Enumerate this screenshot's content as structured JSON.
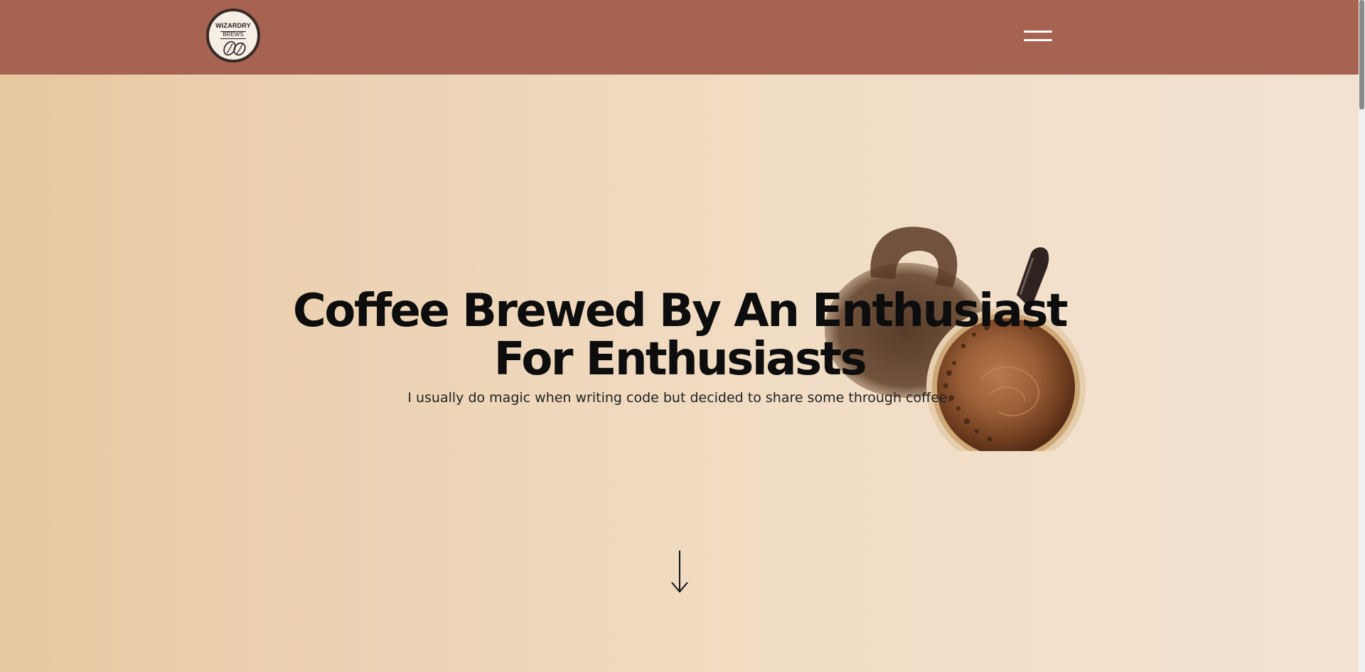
{
  "header": {
    "logo": {
      "title": "WIZARDRY",
      "subtitle": "BREWS",
      "icon": "coffee-beans-icon"
    },
    "menu_icon": "hamburger-menu-icon",
    "background_color": "#a66352"
  },
  "hero": {
    "headline_line1": "Coffee Brewed By An Enthusiast",
    "headline_line2": "For Enthusiasts",
    "subtitle": "I usually do magic when writing code but decided to share some through coffee.",
    "scroll_icon": "arrow-down-icon",
    "image": "coffee-mug-top-view"
  }
}
